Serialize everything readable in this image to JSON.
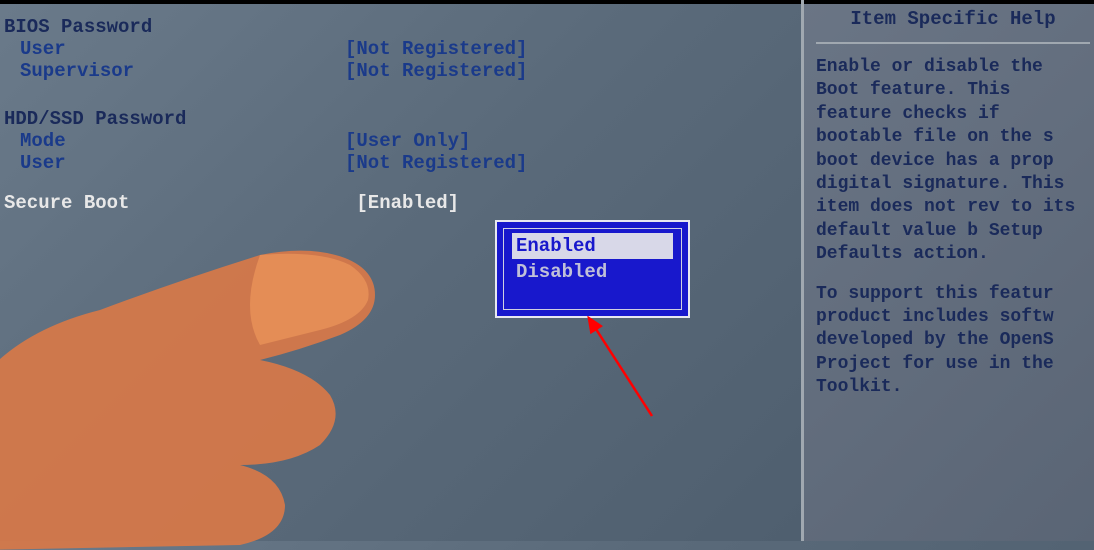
{
  "sections": {
    "bios_password": {
      "header": "BIOS Password",
      "user_label": "User",
      "user_value": "[Not Registered]",
      "supervisor_label": "Supervisor",
      "supervisor_value": "[Not Registered]"
    },
    "hdd_password": {
      "header": "HDD/SSD Password",
      "mode_label": "Mode",
      "mode_value": "[User Only]",
      "user_label": "User",
      "user_value": "[Not Registered]"
    },
    "secure_boot": {
      "label": "Secure Boot",
      "value": "[Enabled]"
    }
  },
  "popup": {
    "option_enabled": "Enabled",
    "option_disabled": "Disabled"
  },
  "help": {
    "title": "Item Specific Help",
    "para1": "Enable or disable the Boot feature. This feature checks if bootable file on the s boot device has a prop digital signature. This item does not rev to its default value b Setup Defaults action.",
    "para2": "To support this featur product includes softw developed by the OpenS Project for use in the Toolkit."
  }
}
